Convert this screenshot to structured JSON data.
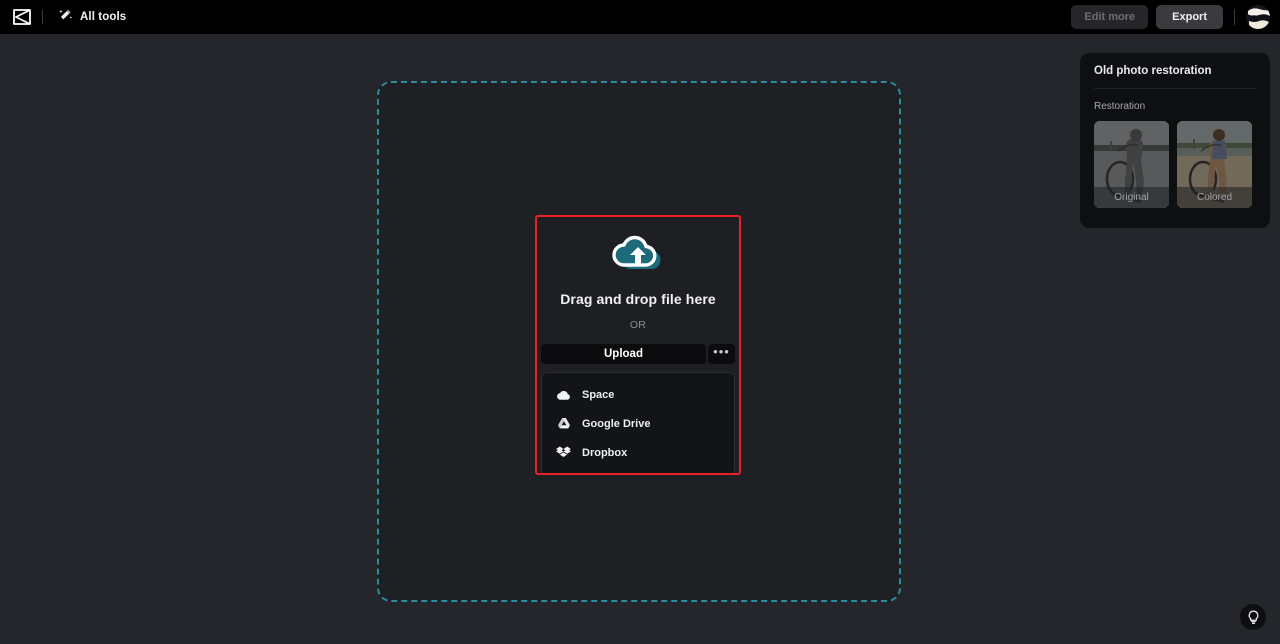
{
  "topbar": {
    "logo_icon": "capcut-logo-icon",
    "all_tools_icon": "magic-wand-icon",
    "all_tools_label": "All tools",
    "edit_more_label": "Edit more",
    "export_label": "Export",
    "avatar_icon": "user-avatar"
  },
  "dropzone": {
    "border_color": "#2a8c9e",
    "background_color": "#1e2024"
  },
  "modal": {
    "highlight_color": "#e8202a",
    "cloud_icon": "cloud-upload-icon",
    "title": "Drag and drop file here",
    "or_text": "OR",
    "upload_label": "Upload",
    "more_label": "•••",
    "menu": [
      {
        "icon": "cloud-space-icon",
        "label": "Space"
      },
      {
        "icon": "google-drive-icon",
        "label": "Google Drive"
      },
      {
        "icon": "dropbox-icon",
        "label": "Dropbox"
      }
    ]
  },
  "right_panel": {
    "title": "Old photo restoration",
    "section_label": "Restoration",
    "thumbnails": [
      {
        "label": "Original",
        "variant": "grayscale"
      },
      {
        "label": "Colored",
        "variant": "color"
      }
    ]
  },
  "help": {
    "icon": "lightbulb-icon"
  }
}
